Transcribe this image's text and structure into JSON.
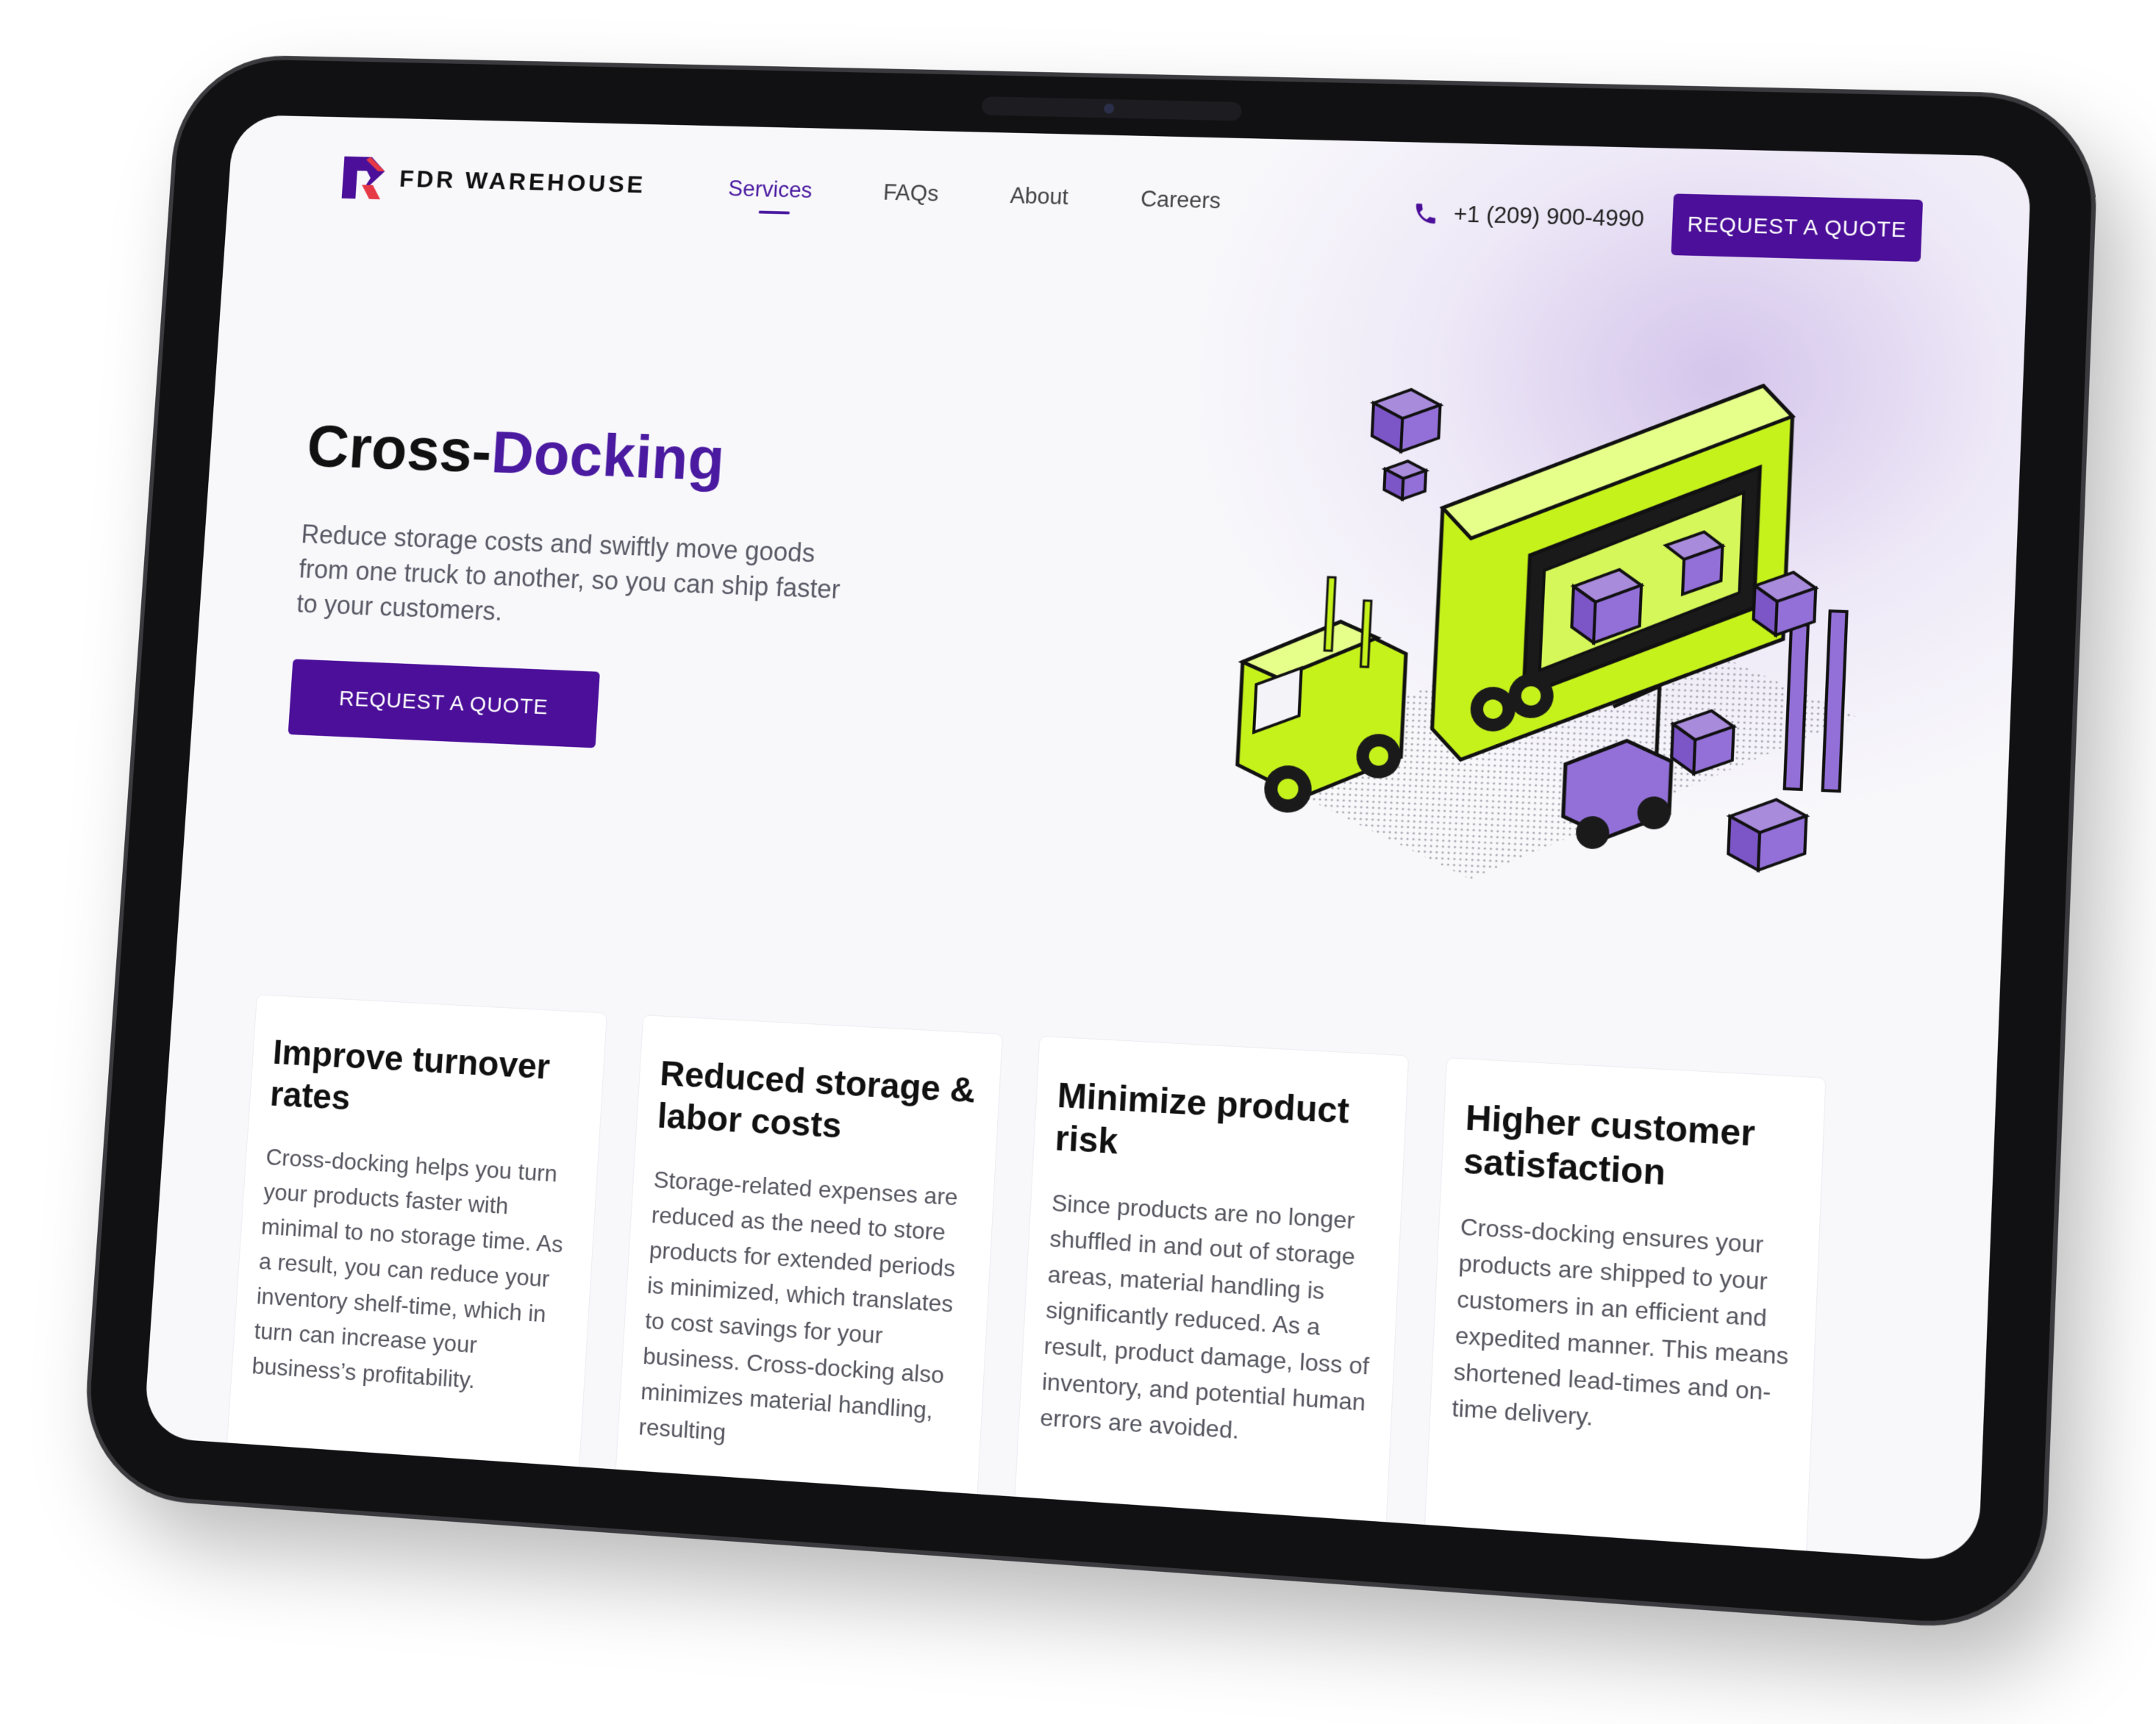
{
  "colors": {
    "brand_purple": "#4b0f99",
    "accent_purple": "#4a1aa0",
    "lime": "#c6f21c",
    "background": "#f8f8fb"
  },
  "header": {
    "logo_text": "FDR WAREHOUSE",
    "nav": [
      {
        "label": "Services",
        "active": true
      },
      {
        "label": "FAQs",
        "active": false
      },
      {
        "label": "About",
        "active": false
      },
      {
        "label": "Careers",
        "active": false
      }
    ],
    "phone": "+1 (209) 900-4990",
    "phone_icon": "phone-icon",
    "cta_label": "REQUEST A QUOTE"
  },
  "hero": {
    "title_part1": "Cross-",
    "title_part2": "Docking",
    "subtitle": "Reduce storage costs and swiftly move goods from one truck to another, so you can ship faster to your customers.",
    "cta_label": "REQUEST A QUOTE",
    "illustration": "cross-docking-truck-forklift-illustration"
  },
  "cards": [
    {
      "title": "Improve turnover rates",
      "body": "Cross-docking helps you turn your products faster with minimal to no storage time. As a result, you can reduce your inventory shelf-time, which in turn can increase your business’s profitability."
    },
    {
      "title": "Reduced storage & labor costs",
      "body": "Storage-related expenses are reduced as the need to store products for extended periods is minimized, which translates to cost savings for your business.  Cross-docking also minimizes material handling, resulting"
    },
    {
      "title": "Minimize product risk",
      "body": "Since products are no longer shuffled in and out of storage areas, material handling is significantly reduced. As a result, product damage, loss of inventory, and potential human errors are avoided."
    },
    {
      "title": "Higher customer satisfaction",
      "body": "Cross-docking ensures your products are shipped to your customers in an efficient and expedited manner. This means shortened lead-times and on-time delivery."
    }
  ]
}
